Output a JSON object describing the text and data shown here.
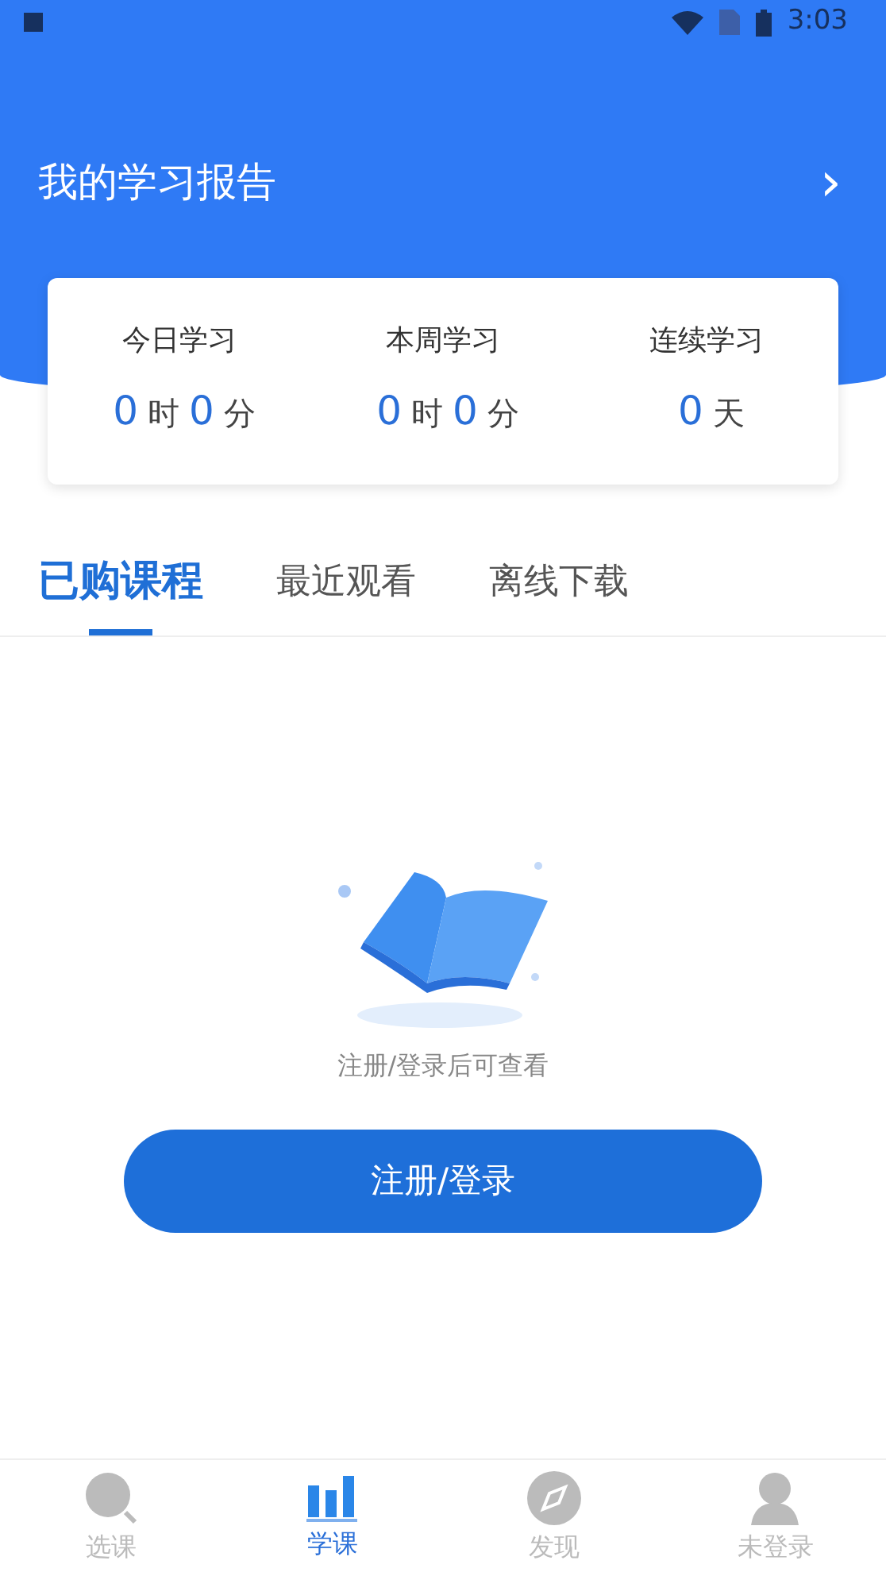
{
  "status_bar": {
    "time": "3:03"
  },
  "header": {
    "title": "我的学习报告",
    "chevron": "›"
  },
  "stats": [
    {
      "label": "今日学习",
      "parts": [
        {
          "kind": "number",
          "text": "0"
        },
        {
          "kind": "unit",
          "text": "时"
        },
        {
          "kind": "number",
          "text": "0"
        },
        {
          "kind": "unit",
          "text": "分"
        }
      ]
    },
    {
      "label": "本周学习",
      "parts": [
        {
          "kind": "number",
          "text": "0"
        },
        {
          "kind": "unit",
          "text": "时"
        },
        {
          "kind": "number",
          "text": "0"
        },
        {
          "kind": "unit",
          "text": "分"
        }
      ]
    },
    {
      "label": "连续学习",
      "parts": [
        {
          "kind": "number",
          "text": "0"
        },
        {
          "kind": "unit",
          "text": "天"
        }
      ]
    }
  ],
  "tabs": [
    {
      "label": "已购课程",
      "selected": true
    },
    {
      "label": "最近观看",
      "selected": false
    },
    {
      "label": "离线下载",
      "selected": false
    }
  ],
  "empty_state": {
    "message": "注册/登录后可查看",
    "button": "注册/登录"
  },
  "bottom_nav": [
    {
      "label": "选课",
      "selected": false
    },
    {
      "label": "学课",
      "selected": true
    },
    {
      "label": "发现",
      "selected": false
    },
    {
      "label": "未登录",
      "selected": false
    }
  ]
}
